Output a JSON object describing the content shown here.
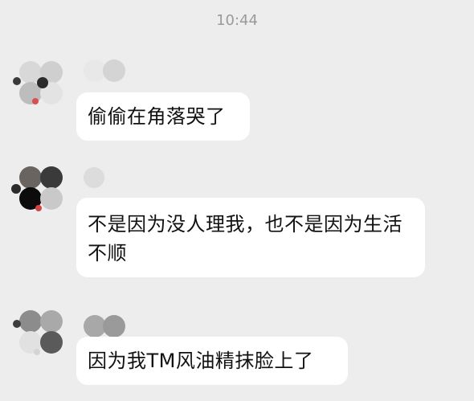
{
  "timestamp": "10:44",
  "messages": [
    {
      "text": "偷偷在角落哭了"
    },
    {
      "text": "不是因为没人理我，也不是因为生活不顺"
    },
    {
      "text": "因为我TM风油精抹脸上了"
    }
  ],
  "colors": {
    "background": "#ededed",
    "bubble": "#ffffff",
    "timestamp_text": "#9a9a9a",
    "message_text": "#111111"
  },
  "icons": {
    "avatar": "avatar-image",
    "nickname": "blurred-nickname"
  }
}
